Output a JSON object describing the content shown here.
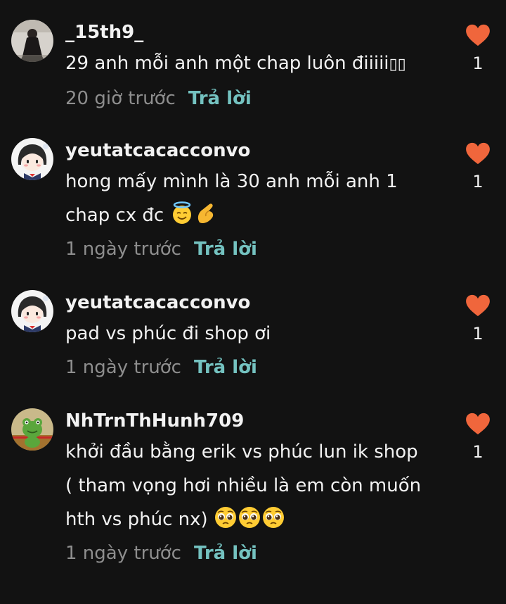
{
  "colors": {
    "background": "#121212",
    "heart": "#f0663c",
    "reply": "#74c2c0",
    "meta": "#8e8e8e"
  },
  "comments": [
    {
      "username": "_15th9_",
      "text_lines": [
        "29 anh mỗi anh một chap luôn điiiii\u0001\u0001"
      ],
      "text_display": "29 anh mỗi anh một chap luôn điiiii",
      "tofu": "▯▯",
      "time": "20 giờ trước",
      "reply_label": "Trả lời",
      "likes": "1",
      "avatar_icon": "dark-figure-avatar-icon"
    },
    {
      "username": "yeutatcacacconvo",
      "line1": "hong mấy mình là 30 anh mỗi anh 1",
      "line2": "chap cx đc",
      "emojis": [
        "halo-smile-emoji",
        "pinching-hand-emoji"
      ],
      "time": "1 ngày trước",
      "reply_label": "Trả lời",
      "likes": "1",
      "avatar_icon": "cartoon-girl-avatar-icon"
    },
    {
      "username": "yeutatcacacconvo",
      "text": "pad vs phúc đi shop ơi",
      "time": "1 ngày trước",
      "reply_label": "Trả lời",
      "likes": "1",
      "avatar_icon": "cartoon-girl-avatar-icon"
    },
    {
      "username": "NhTrnThHunh709",
      "line1": "khởi đầu bằng erik vs phúc lun ik shop",
      "line2": "( tham vọng hơi nhiều là em còn muốn",
      "line3": "hth vs phúc nx)",
      "emojis": [
        "pleading-face-emoji",
        "pleading-face-emoji",
        "pleading-face-emoji"
      ],
      "time": "1 ngày trước",
      "reply_label": "Trả lời",
      "likes": "1",
      "avatar_icon": "green-frog-avatar-icon"
    }
  ]
}
